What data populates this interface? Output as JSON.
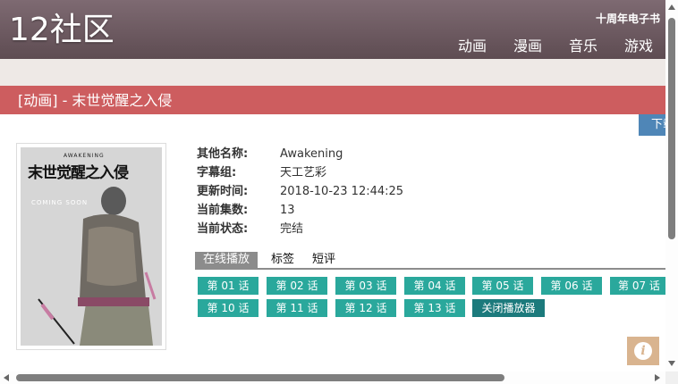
{
  "header": {
    "logo": "12社区",
    "ebook_link": "十周年电子书",
    "nav": [
      "动画",
      "漫画",
      "音乐",
      "游戏"
    ]
  },
  "title_bar": "[动画] - 末世觉醒之入侵",
  "download_label": "下载",
  "poster": {
    "title": "末世觉醒之入侵",
    "subtitle": "AWAKENING",
    "coming_soon": "COMING SOON"
  },
  "info": [
    {
      "label": "其他名称:",
      "value": "Awakening"
    },
    {
      "label": "字幕组:",
      "value": "天工艺彩"
    },
    {
      "label": "更新时间:",
      "value": "2018-10-23 12:44:25"
    },
    {
      "label": "当前集数:",
      "value": "13"
    },
    {
      "label": "当前状态:",
      "value": "完结"
    }
  ],
  "tabs": [
    "在线播放",
    "标签",
    "短评"
  ],
  "episodes": [
    "第 01 话",
    "第 02 话",
    "第 03 话",
    "第 04 话",
    "第 05 话",
    "第 06 话",
    "第 07 话",
    "第 10 话",
    "第 11 话",
    "第 12 话",
    "第 13 话"
  ],
  "close_player": "关闭播放器",
  "info_icon_glyph": "i",
  "colors": {
    "header": "#6e5b62",
    "title_bar": "#cd5d5f",
    "episode_button": "#2aa89c",
    "close_button": "#1c7a7c",
    "download": "#4f86b7"
  }
}
